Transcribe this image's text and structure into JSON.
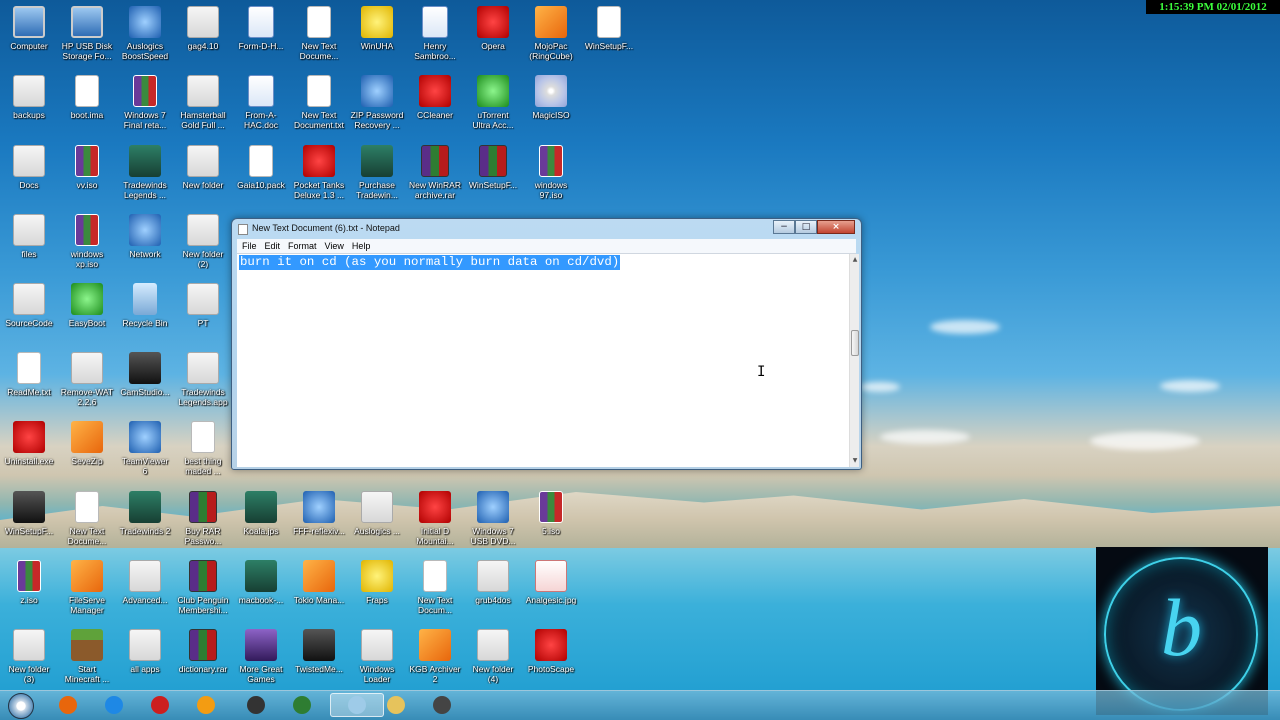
{
  "clock": "1:15:39 PM 02/01/2012",
  "desktop_icons": [
    {
      "label": "Computer",
      "kind": "computer"
    },
    {
      "label": "HP USB Disk\nStorage Fo...",
      "kind": "computer"
    },
    {
      "label": "Auslogics\nBoostSpeed",
      "kind": "blue"
    },
    {
      "label": "gag4.10",
      "kind": "folder"
    },
    {
      "label": "Form-D-H...",
      "kind": "word"
    },
    {
      "label": "New Text\nDocume...",
      "kind": "doc"
    },
    {
      "label": "WinUHA",
      "kind": "yellow"
    },
    {
      "label": "Henry\nSambroo...",
      "kind": "word"
    },
    {
      "label": "Opera",
      "kind": "red"
    },
    {
      "label": "MojoPac\n(RingCube)",
      "kind": "orange"
    },
    {
      "label": "WinSetupF...",
      "kind": "doc"
    },
    {
      "label": "backups",
      "kind": "folder"
    },
    {
      "label": "boot.ima",
      "kind": "doc"
    },
    {
      "label": "Windows 7\nFinal reta...",
      "kind": "iso"
    },
    {
      "label": "Hamsterball\nGold Full ...",
      "kind": "folder"
    },
    {
      "label": "From-A-\nHAC.doc",
      "kind": "word"
    },
    {
      "label": "New Text\nDocument.txt",
      "kind": "doc"
    },
    {
      "label": "ZIP Password\nRecovery ...",
      "kind": "blue"
    },
    {
      "label": "CCleaner",
      "kind": "red"
    },
    {
      "label": "uTorrent\nUltra Acc...",
      "kind": "green"
    },
    {
      "label": "MagicISO",
      "kind": "disc"
    },
    {
      "label": "Docs",
      "kind": "folder"
    },
    {
      "label": "vv.iso",
      "kind": "iso"
    },
    {
      "label": "Tradewinds\nLegends ...",
      "kind": "teal"
    },
    {
      "label": "New folder",
      "kind": "folder"
    },
    {
      "label": "Gaia10.pack",
      "kind": "doc"
    },
    {
      "label": "Pocket Tanks\nDeluxe 1.3 ...",
      "kind": "red"
    },
    {
      "label": "Purchase\nTradewin...",
      "kind": "teal"
    },
    {
      "label": "New WinRAR\narchive.rar",
      "kind": "rar"
    },
    {
      "label": "WinSetupF...",
      "kind": "rar"
    },
    {
      "label": "windows\n97.iso",
      "kind": "iso"
    },
    {
      "label": "files",
      "kind": "folder"
    },
    {
      "label": "windows\nxp.iso",
      "kind": "iso"
    },
    {
      "label": "Network",
      "kind": "blue"
    },
    {
      "label": "New folder\n(2)",
      "kind": "folder"
    },
    {
      "label": "SourceCode",
      "kind": "folder"
    },
    {
      "label": "EasyBoot",
      "kind": "green"
    },
    {
      "label": "Recycle Bin",
      "kind": "recycle"
    },
    {
      "label": "PT",
      "kind": "folder"
    },
    {
      "label": "ReadMe.txt",
      "kind": "doc"
    },
    {
      "label": "Remove-WAT\n2.2.6",
      "kind": "folder"
    },
    {
      "label": "CamStudio...",
      "kind": "dark"
    },
    {
      "label": "Tradewinds\nLegends.app",
      "kind": "folder"
    },
    {
      "label": "Uninstall.exe",
      "kind": "red"
    },
    {
      "label": "SeveZip",
      "kind": "orange"
    },
    {
      "label": "TeamViewer\n6",
      "kind": "blue"
    },
    {
      "label": "best thing\nmaded ...",
      "kind": "doc"
    },
    {
      "label": "WinSetupF...",
      "kind": "dark"
    },
    {
      "label": "New Text\nDocume...",
      "kind": "doc"
    },
    {
      "label": "Tradewinds 2",
      "kind": "teal"
    },
    {
      "label": "Buy RAR\nPasswo...",
      "kind": "rar"
    },
    {
      "label": "Koala.jps",
      "kind": "teal"
    },
    {
      "label": "FFF-reflexiv...",
      "kind": "blue"
    },
    {
      "label": "Auslogics ...",
      "kind": "folder"
    },
    {
      "label": "Initial D\nMountai...",
      "kind": "red"
    },
    {
      "label": "Windows 7\nUSB DVD...",
      "kind": "blue"
    },
    {
      "label": "5.iso",
      "kind": "iso"
    },
    {
      "label": "z.iso",
      "kind": "iso"
    },
    {
      "label": "FileServe\nManager",
      "kind": "orange"
    },
    {
      "label": "Advanced...",
      "kind": "folder"
    },
    {
      "label": "Club Penguin\nMembershi...",
      "kind": "rar"
    },
    {
      "label": "macbook-...",
      "kind": "teal"
    },
    {
      "label": "Tokio Mana...",
      "kind": "orange"
    },
    {
      "label": "Fraps",
      "kind": "yellow"
    },
    {
      "label": "New Text\nDocum...",
      "kind": "doc"
    },
    {
      "label": "grub4dos",
      "kind": "folder"
    },
    {
      "label": "Analgesic.jpg",
      "kind": "pink"
    },
    {
      "label": "New folder\n(3)",
      "kind": "folder"
    },
    {
      "label": "Start\nMinecraft ...",
      "kind": "minecraft"
    },
    {
      "label": "all apps",
      "kind": "folder"
    },
    {
      "label": "dictionary.rar",
      "kind": "rar"
    },
    {
      "label": "More Great\nGames",
      "kind": "purple"
    },
    {
      "label": "TwistedMe...",
      "kind": "dark"
    },
    {
      "label": "Windows\nLoader",
      "kind": "folder"
    },
    {
      "label": "KGB Archiver\n2",
      "kind": "orange"
    },
    {
      "label": "New folder\n(4)",
      "kind": "folder"
    },
    {
      "label": "PhotoScape",
      "kind": "red"
    }
  ],
  "notepad": {
    "title": "New Text Document (6).txt - Notepad",
    "menu": [
      "File",
      "Edit",
      "Format",
      "View",
      "Help"
    ],
    "text": "burn it on cd (as you normally burn data on cd/dvd)",
    "selected": true,
    "controls": {
      "minimize": "−",
      "maximize": "□",
      "close": "×"
    }
  },
  "taskbar": {
    "items": [
      {
        "name": "firefox",
        "color": "#e8660c"
      },
      {
        "name": "internet-explorer",
        "color": "#1e88e5"
      },
      {
        "name": "opera",
        "color": "#cc1f1f"
      },
      {
        "name": "media-player",
        "color": "#f39c12"
      },
      {
        "name": "camstudio",
        "color": "#333333"
      },
      {
        "name": "utorrent",
        "color": "#2e7d32"
      },
      {
        "name": "notepad",
        "color": "#9ecbe8"
      },
      {
        "name": "explorer",
        "color": "#e6c35c"
      },
      {
        "name": "unknown-app",
        "color": "#444444"
      }
    ]
  },
  "logo": {
    "letter": "b"
  },
  "colors": {
    "selection": "#3399ff",
    "clock_text": "#3cff3c"
  }
}
